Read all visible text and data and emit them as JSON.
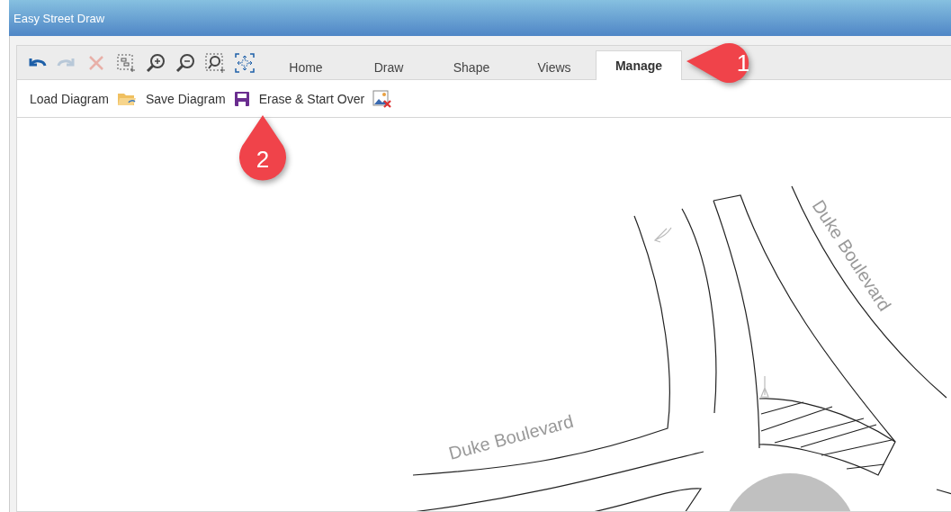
{
  "window": {
    "title": "Easy Street Draw"
  },
  "toolbar": {
    "icons": [
      {
        "kind": "undo",
        "disabled": false
      },
      {
        "kind": "redo",
        "disabled": true
      },
      {
        "kind": "delete",
        "disabled": true
      },
      {
        "kind": "select",
        "disabled": false
      },
      {
        "kind": "zoom-in",
        "disabled": false
      },
      {
        "kind": "zoom-out",
        "disabled": false
      },
      {
        "kind": "zoom-area",
        "disabled": false
      },
      {
        "kind": "fit",
        "disabled": false
      }
    ]
  },
  "tabs": [
    {
      "label": "Home",
      "selected": false
    },
    {
      "label": "Draw",
      "selected": false
    },
    {
      "label": "Shape",
      "selected": false
    },
    {
      "label": "Views",
      "selected": false
    },
    {
      "label": "Manage",
      "selected": true
    }
  ],
  "actions": [
    {
      "label": "Load Diagram",
      "kind": "load"
    },
    {
      "label": "Save Diagram",
      "kind": "save"
    },
    {
      "label": "Erase & Start Over",
      "kind": "erase"
    }
  ],
  "callouts": [
    {
      "label": "1",
      "kind": "left"
    },
    {
      "label": "2",
      "kind": "up"
    }
  ],
  "canvas": {
    "street_labels": [
      {
        "label": "Duke Boulevard"
      },
      {
        "label": "Duke Boulevard"
      }
    ]
  }
}
